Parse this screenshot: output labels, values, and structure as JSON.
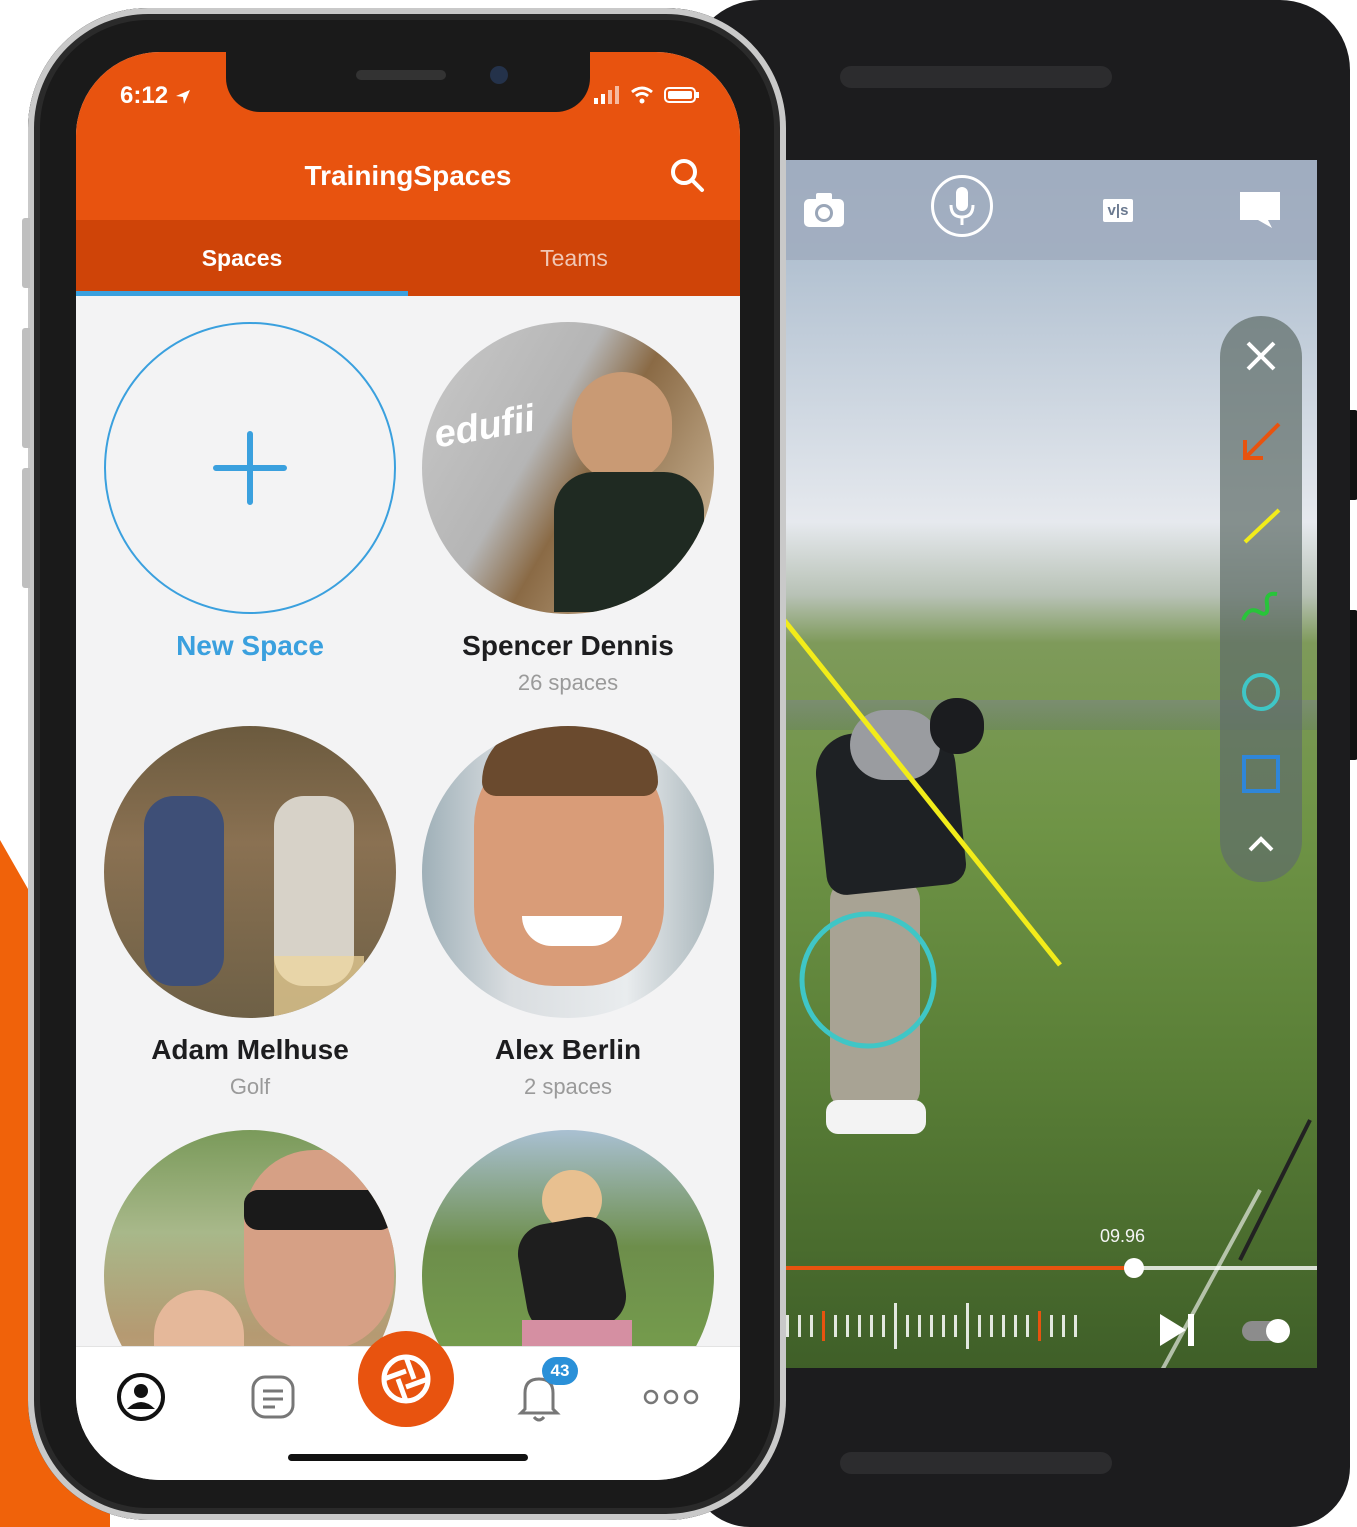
{
  "ios": {
    "status": {
      "time": "6:12"
    },
    "header": {
      "title": "TrainingSpaces"
    },
    "tabs": [
      {
        "label": "Spaces",
        "active": true
      },
      {
        "label": "Teams",
        "active": false
      }
    ],
    "cards": [
      {
        "name": "New Space",
        "sub": ""
      },
      {
        "name": "Spencer Dennis",
        "sub": "26 spaces"
      },
      {
        "name": "Adam Melhuse",
        "sub": "Golf"
      },
      {
        "name": "Alex Berlin",
        "sub": "2 spaces"
      },
      {
        "name": "",
        "sub": ""
      },
      {
        "name": "",
        "sub": ""
      }
    ],
    "tabbar": {
      "items": [
        "profile-icon",
        "notes-icon",
        "capture-icon",
        "bell-icon",
        "more-icon"
      ],
      "badge": "43"
    },
    "colors": {
      "accent": "#e8530f",
      "tab_dark": "#cf4408",
      "link": "#3aa0de"
    }
  },
  "android": {
    "toolbar": {
      "icons": [
        "camera-icon",
        "microphone-icon",
        "compare-icon",
        "comment-icon"
      ],
      "vs_label": "v|s"
    },
    "draw_tools": [
      "close-icon",
      "arrow-tool-icon",
      "line-tool-icon",
      "freehand-tool-icon",
      "circle-tool-icon",
      "rectangle-tool-icon",
      "collapse-icon"
    ],
    "video": {
      "time": "09.96",
      "progress_fraction": 0.66
    }
  }
}
